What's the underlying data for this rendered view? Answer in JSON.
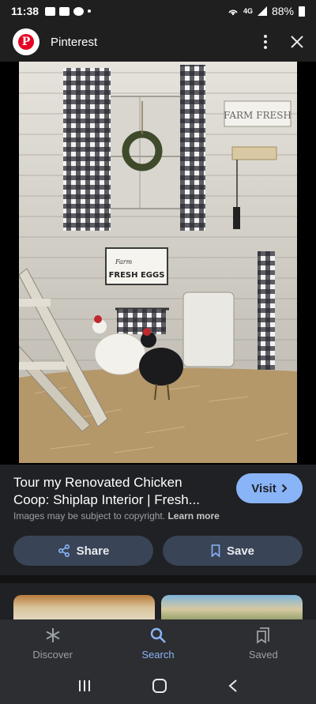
{
  "status_bar": {
    "time": "11:38",
    "battery": "88%",
    "network": "4G"
  },
  "header": {
    "site_name": "Pinterest",
    "logo_letter": "P",
    "brand_color": "#e60023"
  },
  "image": {
    "sign_farm_fresh": "FARM FRESH",
    "sign_small": "Farm",
    "sign_fresh_eggs": "FRESH EGGS"
  },
  "result": {
    "title": "Tour my Renovated Chicken Coop: Shiplap Interior | Fresh...",
    "visit_label": "Visit",
    "copyright_text": "Images may be subject to copyright.",
    "learn_more": "Learn more",
    "share_label": "Share",
    "save_label": "Save",
    "accent_color": "#8ab4f8"
  },
  "bottom_nav": {
    "items": [
      {
        "label": "Discover",
        "icon": "asterisk-icon"
      },
      {
        "label": "Search",
        "icon": "search-icon"
      },
      {
        "label": "Saved",
        "icon": "collections-icon"
      }
    ],
    "active": "Search"
  }
}
